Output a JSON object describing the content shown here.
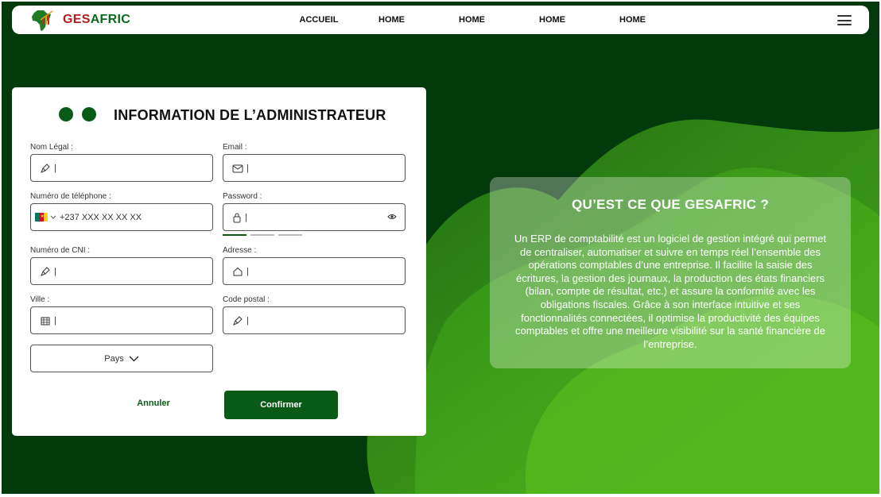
{
  "navbar": {
    "brand_part1": "GES",
    "brand_part2": "AFRIC",
    "links": [
      "ACCUEIL",
      "HOME",
      "HOME",
      "HOME",
      "HOME"
    ],
    "menu_icon": "hamburger-icon"
  },
  "form": {
    "title": "INFORMATION DE L’ADMINISTRATEUR",
    "nom_legal": {
      "label": "Nom Légal :",
      "value": "|",
      "icon": "pen-icon"
    },
    "email": {
      "label": "Email :",
      "value": "|",
      "icon": "mail-icon"
    },
    "telephone": {
      "label": "Numéro de téléphone :",
      "value": "+237 XXX XX XX XX",
      "icon": "cameroon-flag-icon"
    },
    "password": {
      "label": "Password :",
      "value": "|",
      "icon": "lock-icon",
      "toggle_icon": "eye-icon",
      "strength_segments": 3,
      "strength_level": 1
    },
    "cni": {
      "label": "Numéro de CNI :",
      "value": "|",
      "icon": "pen-icon"
    },
    "adresse": {
      "label": "Adresse :",
      "value": "|",
      "icon": "home-icon"
    },
    "ville": {
      "label": "Ville :",
      "value": "|",
      "icon": "building-icon"
    },
    "code_postal": {
      "label": "Code postal :",
      "value": "|",
      "icon": "pen-icon"
    },
    "pays": {
      "label": "Pays"
    },
    "cancel_label": "Annuler",
    "confirm_label": "Confirmer"
  },
  "info": {
    "title": "QU’EST CE QUE GESAFRIC ?",
    "body": "Un ERP de comptabilité est un logiciel de gestion intégré qui permet de centraliser, automatiser et suivre en temps réel l’ensemble des opérations comptables d’une entreprise. Il facilite la saisie des écritures, la gestion des journaux, la production des états financiers (bilan, compte de résultat, etc.) et assure la conformité avec les obligations fiscales. Grâce à son interface intuitive et ses fonctionnalités connectées, il optimise la productivité des équipes comptables et offre une meilleure visibilité sur la santé financière de l’entreprise."
  },
  "colors": {
    "background": "#033a0c",
    "primary": "#0a5a17",
    "brand_red": "#b11d1d",
    "brand_green": "#0a6b1e",
    "blob_green": "#3da51e"
  }
}
